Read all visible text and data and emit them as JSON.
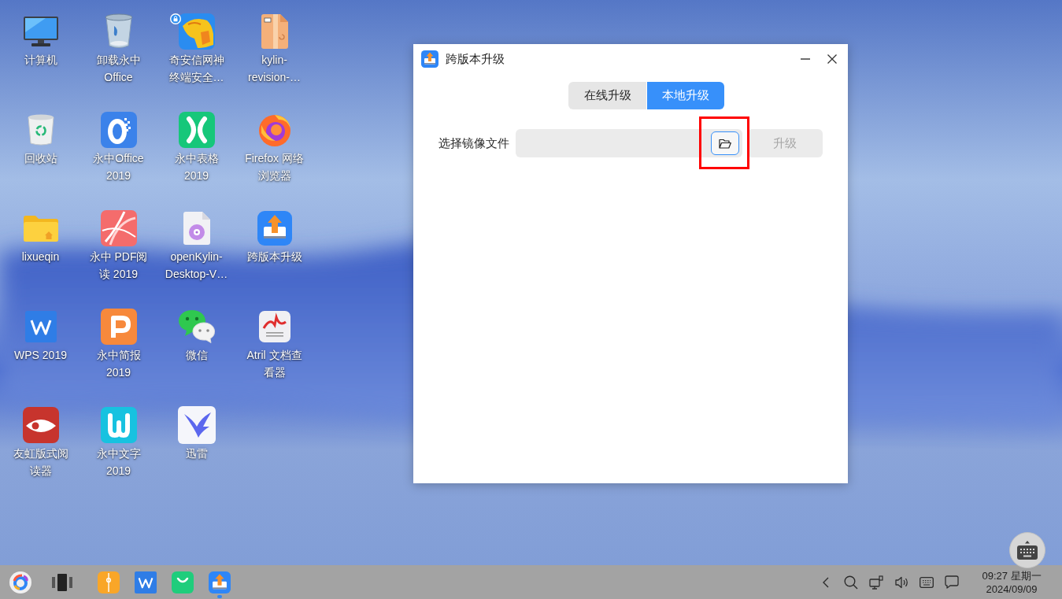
{
  "desktop": {
    "icons": [
      {
        "label": "计算机"
      },
      {
        "label": "卸载永中Office"
      },
      {
        "label": "奇安信网神终端安全…"
      },
      {
        "label": "kylin-revision-…"
      },
      {
        "label": "回收站"
      },
      {
        "label": "永中Office 2019"
      },
      {
        "label": "永中表格 2019"
      },
      {
        "label": "Firefox 网络浏览器"
      },
      {
        "label": "lixueqin"
      },
      {
        "label": "永中 PDF阅读 2019"
      },
      {
        "label": "openKylin-Desktop-V…"
      },
      {
        "label": "跨版本升级"
      },
      {
        "label": "WPS 2019"
      },
      {
        "label": "永中简报 2019"
      },
      {
        "label": "微信"
      },
      {
        "label": "Atril 文档查看器"
      },
      {
        "label": "友虹版式阅读器"
      },
      {
        "label": "永中文字 2019"
      },
      {
        "label": "迅雷"
      }
    ]
  },
  "window": {
    "title": "跨版本升级",
    "tabs": [
      {
        "label": "在线升级",
        "selected": false
      },
      {
        "label": "本地升级",
        "selected": true
      }
    ],
    "file_label": "选择镜像文件",
    "browse_button": {
      "highlighted": true
    },
    "upgrade_button": {
      "label": "升级",
      "disabled": true
    }
  },
  "taskbar": {
    "apps": [
      {
        "active": false
      },
      {
        "active": false
      },
      {
        "active": false
      },
      {
        "active": true
      }
    ],
    "clock": {
      "time": "09:27 星期一",
      "date": "2024/09/09"
    }
  }
}
